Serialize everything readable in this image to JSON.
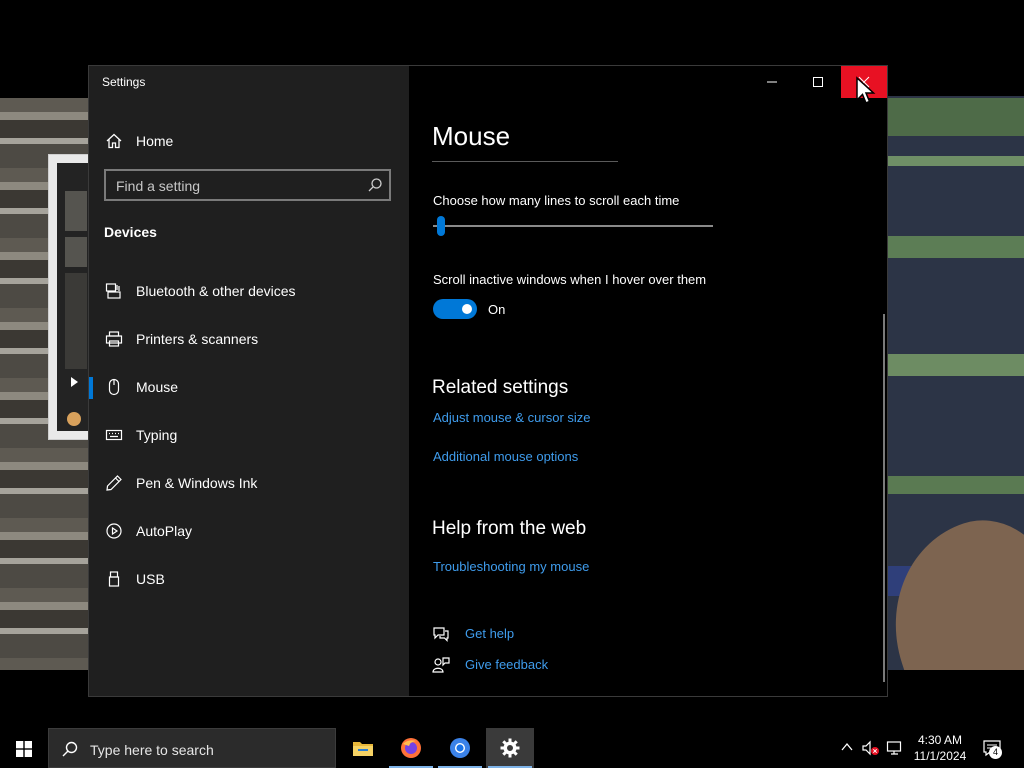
{
  "window": {
    "app_title": "Settings",
    "home_label": "Home",
    "search_placeholder": "Find a setting",
    "section_label": "Devices",
    "nav_items": [
      {
        "label": "Bluetooth & other devices",
        "icon": "bluetooth-devices-icon"
      },
      {
        "label": "Printers & scanners",
        "icon": "printer-icon"
      },
      {
        "label": "Mouse",
        "icon": "mouse-icon",
        "selected": true
      },
      {
        "label": "Typing",
        "icon": "keyboard-icon"
      },
      {
        "label": "Pen & Windows Ink",
        "icon": "pen-icon"
      },
      {
        "label": "AutoPlay",
        "icon": "autoplay-icon"
      },
      {
        "label": "USB",
        "icon": "usb-icon"
      }
    ]
  },
  "content": {
    "title": "Mouse",
    "scroll_lines_label": "Choose how many lines to scroll each time",
    "scroll_lines_value": 1,
    "inactive_scroll_label": "Scroll inactive windows when I hover over them",
    "inactive_scroll_state": "On",
    "related_heading": "Related settings",
    "related_links": [
      "Adjust mouse & cursor size",
      "Additional mouse options"
    ],
    "help_heading": "Help from the web",
    "help_web_links": [
      "Troubleshooting my mouse"
    ],
    "get_help": "Get help",
    "give_feedback": "Give feedback"
  },
  "taskbar": {
    "search_placeholder": "Type here to search",
    "apps": [
      "file-explorer-icon",
      "firefox-icon",
      "chrome-icon",
      "settings-icon"
    ],
    "time": "4:30 AM",
    "date": "11/1/2024",
    "notification_count": "4"
  },
  "colors": {
    "accent": "#0078d7",
    "link": "#3f9cec",
    "close_hover": "#e81123",
    "sidebar_bg": "#1f1f1f"
  }
}
